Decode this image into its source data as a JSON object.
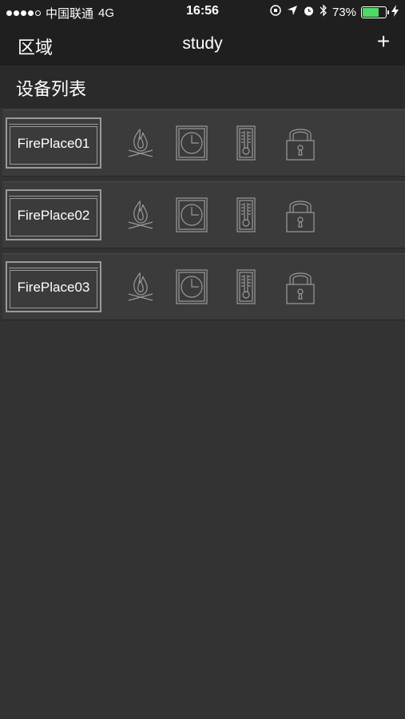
{
  "status_bar": {
    "carrier": "中国联通",
    "network": "4G",
    "time": "16:56",
    "battery": "73%",
    "battery_level": 0.73,
    "battery_color": "#4cd964"
  },
  "nav": {
    "left_label": "区域",
    "title": "study",
    "add_label": "+"
  },
  "section": {
    "title": "设备列表"
  },
  "devices": [
    {
      "name": "FirePlace01"
    },
    {
      "name": "FirePlace02"
    },
    {
      "name": "FirePlace03"
    }
  ],
  "icons": [
    "flame-icon",
    "clock-icon",
    "thermometer-icon",
    "lock-icon"
  ],
  "colors": {
    "background": "#333333",
    "bar": "#1f1f1f",
    "row": "#3b3b3b",
    "icon_stroke": "#9a9a9a"
  }
}
